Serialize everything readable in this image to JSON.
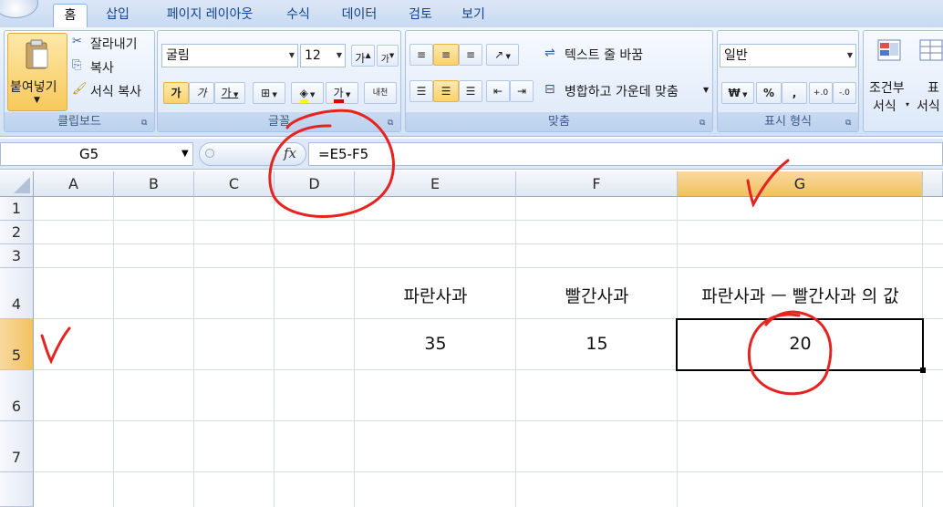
{
  "tabs": [
    {
      "label": "홈",
      "active": true
    },
    {
      "label": "삽입"
    },
    {
      "label": "페이지 레이아웃"
    },
    {
      "label": "수식"
    },
    {
      "label": "데이터"
    },
    {
      "label": "검토"
    },
    {
      "label": "보기"
    }
  ],
  "ribbon": {
    "clipboard": {
      "paste": "붙여넣기",
      "cut": "잘라내기",
      "copy": "복사",
      "format_painter": "서식 복사",
      "label": "클립보드"
    },
    "font": {
      "name": "굴림",
      "size": "12",
      "grow": "가",
      "shrink": "가",
      "bold": "가",
      "italic": "가",
      "underline": "가",
      "fontcolor": "가",
      "phonetic": "내천",
      "label": "글꼴"
    },
    "align": {
      "wrap": "텍스트 줄 바꿈",
      "merge": "병합하고 가운데 맞춤",
      "label": "맞춤"
    },
    "number": {
      "format": "일반",
      "currency": "₩",
      "percent": "%",
      "comma": ",",
      "inc": "+.0",
      "dec": "-.0",
      "label": "표시 형식"
    },
    "styles": {
      "conditional_line1": "조건부",
      "conditional_line2": "서식",
      "table_line1": "표",
      "table_line2": "서식"
    }
  },
  "formula_bar": {
    "name_box": "G5",
    "fx": "fx",
    "formula": "=E5-F5"
  },
  "grid": {
    "columns": [
      "A",
      "B",
      "C",
      "D",
      "E",
      "F",
      "G"
    ],
    "selected_column": "G",
    "rows": [
      "1",
      "2",
      "3",
      "4",
      "5",
      "6",
      "7"
    ],
    "selected_cell": "G5",
    "cells": {
      "E4": "파란사과",
      "F4": "빨간사과",
      "G4": "파란사과 ㅡ 빨간사과 의 값",
      "E5": "35",
      "F5": "15",
      "G5": "20"
    }
  },
  "colors": {
    "annotation": "#e52420",
    "selected_header": "#f3c766",
    "ribbon_bg": "#dde8f7"
  }
}
